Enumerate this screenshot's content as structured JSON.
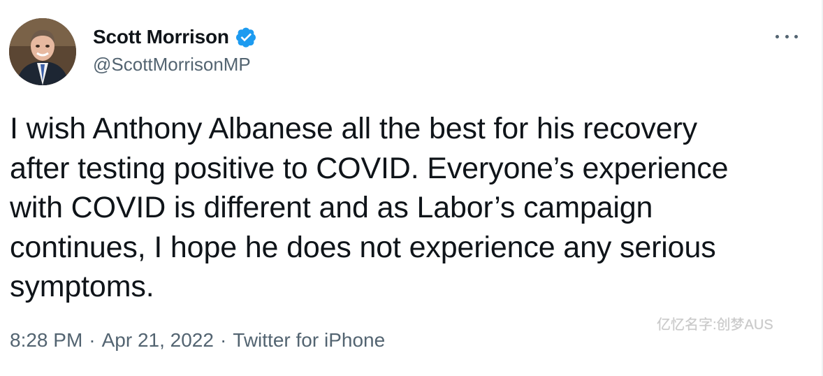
{
  "author": {
    "display_name": "Scott Morrison",
    "handle": "@ScottMorrisonMP",
    "verified": true,
    "verified_icon": "verified-badge-icon",
    "avatar": "profile-photo"
  },
  "tweet": {
    "text": "I wish Anthony Albanese all the best for his recovery\nafter testing positive to COVID. Everyone’s experience\nwith COVID is different and as Labor’s campaign\ncontinues, I hope he does not experience any serious\nsymptoms."
  },
  "meta": {
    "time": "8:28 PM",
    "separator_1": "·",
    "date": "Apr 21, 2022",
    "separator_2": "·",
    "source": "Twitter for iPhone"
  },
  "menu": {
    "icon": "more-options-icon"
  },
  "watermark": {
    "text": "亿忆名字:创梦AUS"
  },
  "colors": {
    "text_primary": "#0f1419",
    "text_secondary": "#536471",
    "verified_blue": "#1d9bf0"
  }
}
